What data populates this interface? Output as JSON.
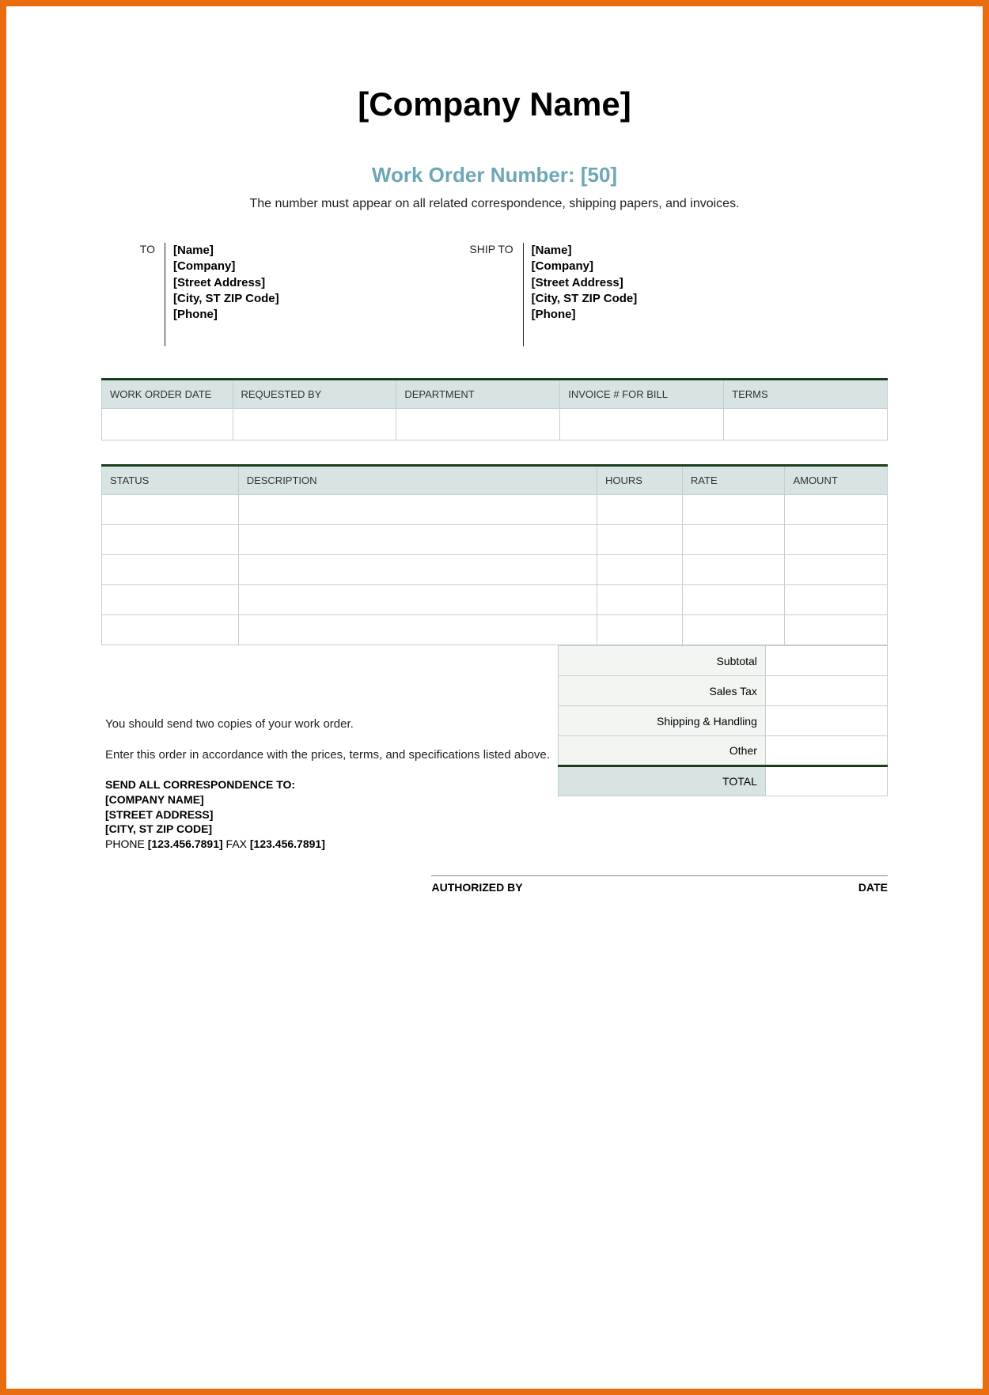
{
  "header": {
    "company_name": "[Company Name]",
    "work_order_number": "Work Order Number: [50]",
    "note": "The number must appear on all related correspondence, shipping papers, and invoices."
  },
  "to": {
    "label": "TO",
    "name": "[Name]",
    "company": "[Company]",
    "street": "[Street Address]",
    "city": "[City, ST  ZIP Code]",
    "phone": "[Phone]"
  },
  "ship_to": {
    "label": "SHIP TO",
    "name": "[Name]",
    "company": "[Company]",
    "street": "[Street Address]",
    "city": "[City, ST  ZIP Code]",
    "phone": "[Phone]"
  },
  "info_headers": {
    "date": "WORK ORDER DATE",
    "requested_by": "REQUESTED BY",
    "department": "DEPARTMENT",
    "invoice": "INVOICE # FOR BILL",
    "terms": "TERMS"
  },
  "line_headers": {
    "status": "STATUS",
    "description": "DESCRIPTION",
    "hours": "HOURS",
    "rate": "RATE",
    "amount": "AMOUNT"
  },
  "totals": {
    "subtotal_label": "Subtotal",
    "sales_tax_label": "Sales Tax",
    "shipping_label": "Shipping & Handling",
    "other_label": "Other",
    "total_label": "TOTAL"
  },
  "notes": {
    "line1": "You should send two copies of your work order.",
    "line2": "Enter this order in accordance with the prices, terms, and specifications listed above."
  },
  "correspondence": {
    "heading": "SEND ALL CORRESPONDENCE TO:",
    "company": "[COMPANY NAME]",
    "street": "[STREET ADDRESS]",
    "city": "[CITY, ST  ZIP CODE]",
    "phone_prefix": "PHONE ",
    "phone": "[123.456.7891]",
    "fax_prefix": "  FAX ",
    "fax": "[123.456.7891]"
  },
  "sign": {
    "authorized": "AUTHORIZED BY",
    "date": "DATE"
  }
}
